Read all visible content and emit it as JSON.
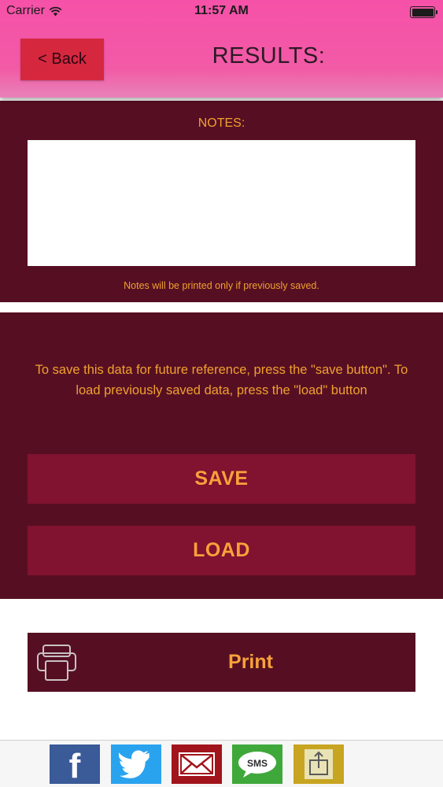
{
  "status_bar": {
    "carrier": "Carrier",
    "time": "11:57 AM"
  },
  "nav": {
    "back_label": "< Back",
    "title": "RESULTS:"
  },
  "notes": {
    "label": "NOTES:",
    "value": "",
    "hint": "Notes will be printed only if previously saved."
  },
  "actions": {
    "instructions": "To save this data for future reference, press the \"save button\". To load previously saved data,  press the \"load\" button",
    "save_label": "SAVE",
    "load_label": "LOAD",
    "print_label": "Print"
  },
  "share_bar": {
    "items": [
      {
        "icon": "facebook-icon",
        "label": "f"
      },
      {
        "icon": "twitter-icon"
      },
      {
        "icon": "mail-icon"
      },
      {
        "icon": "sms-icon",
        "label": "SMS"
      },
      {
        "icon": "share-icon"
      }
    ]
  },
  "colors": {
    "header_pink": "#f651a8",
    "panel_maroon": "#560f22",
    "button_crimson": "#811230",
    "accent_orange": "#f0a030",
    "back_button_red": "#d5283f"
  }
}
